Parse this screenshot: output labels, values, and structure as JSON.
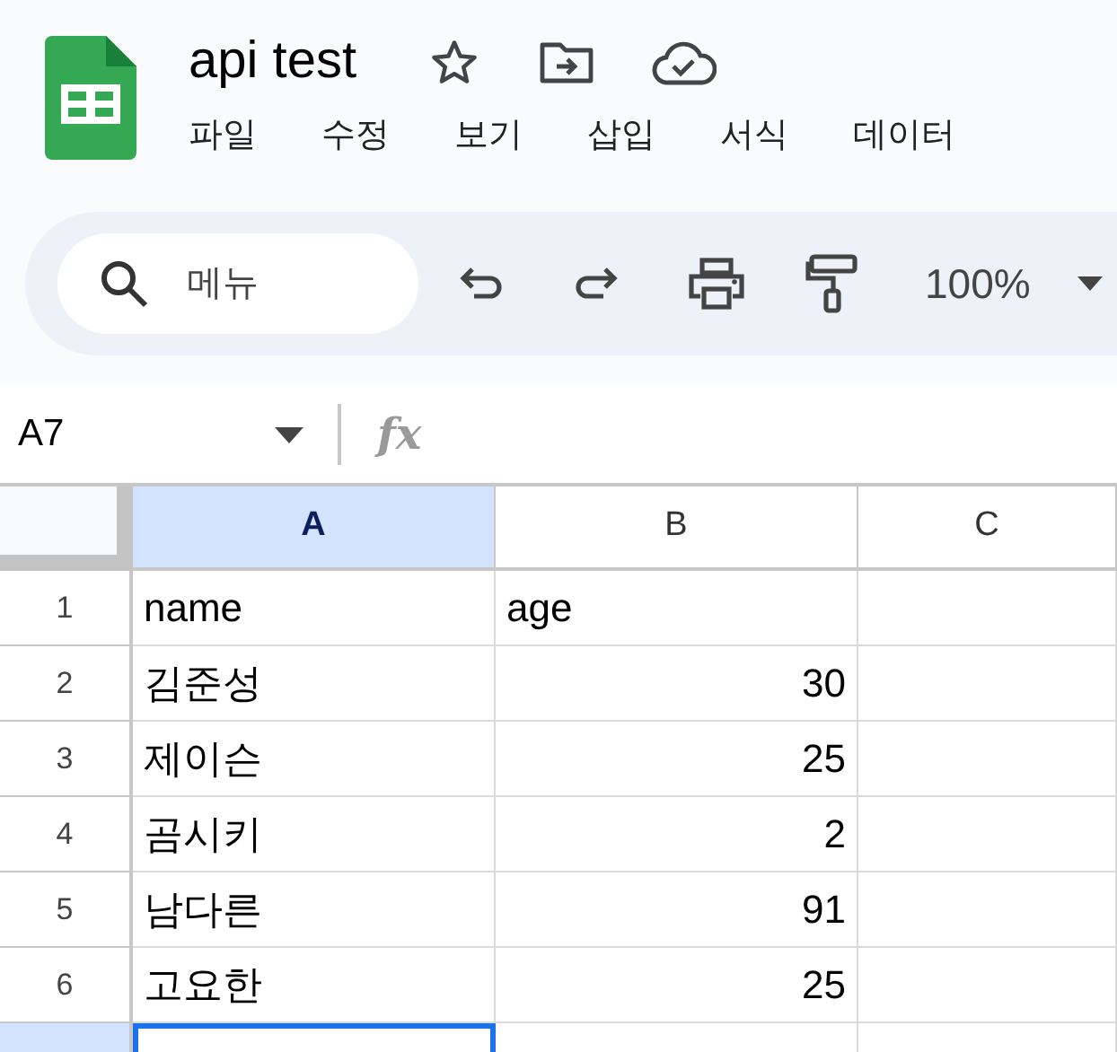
{
  "document": {
    "title": "api test"
  },
  "menu": [
    "파일",
    "수정",
    "보기",
    "삽입",
    "서식",
    "데이터"
  ],
  "toolbar": {
    "search": {
      "placeholder": "메뉴"
    },
    "zoom": "100%"
  },
  "formula_bar": {
    "name_box": "A7",
    "fx_label": "fx"
  },
  "columns": [
    {
      "label": "A",
      "selected": true
    },
    {
      "label": "B",
      "selected": false
    },
    {
      "label": "C",
      "selected": false
    }
  ],
  "rows": [
    {
      "number": "1",
      "selected": false,
      "cells": [
        {
          "text": "name",
          "kind": "text"
        },
        {
          "text": "age",
          "kind": "text"
        }
      ]
    },
    {
      "number": "2",
      "selected": false,
      "cells": [
        {
          "text": "김준성",
          "kind": "text"
        },
        {
          "text": "30",
          "kind": "number"
        }
      ]
    },
    {
      "number": "3",
      "selected": false,
      "cells": [
        {
          "text": "제이슨",
          "kind": "text"
        },
        {
          "text": "25",
          "kind": "number"
        }
      ]
    },
    {
      "number": "4",
      "selected": false,
      "cells": [
        {
          "text": "곰시키",
          "kind": "text"
        },
        {
          "text": "2",
          "kind": "number"
        }
      ]
    },
    {
      "number": "5",
      "selected": false,
      "cells": [
        {
          "text": "남다른",
          "kind": "text"
        },
        {
          "text": "91",
          "kind": "number"
        }
      ]
    },
    {
      "number": "6",
      "selected": false,
      "cells": [
        {
          "text": "고요한",
          "kind": "text"
        },
        {
          "text": "25",
          "kind": "number"
        }
      ]
    },
    {
      "selected": true,
      "cells": []
    }
  ]
}
